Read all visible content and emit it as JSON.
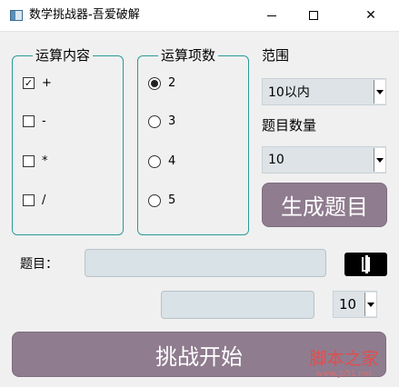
{
  "window": {
    "title": "数学挑战器-吾爱破解",
    "minimize_icon": "minimize-icon",
    "maximize_icon": "maximize-icon",
    "close_icon": "close-icon",
    "close_glyph": "✕"
  },
  "operations_group": {
    "title": "运算内容",
    "items": [
      {
        "label": "+",
        "checked": true
      },
      {
        "label": "-",
        "checked": false
      },
      {
        "label": "*",
        "checked": false
      },
      {
        "label": "/",
        "checked": false
      }
    ],
    "check_glyph": "✓"
  },
  "operands_group": {
    "title": "运算项数",
    "options": [
      {
        "label": "2",
        "selected": true
      },
      {
        "label": "3",
        "selected": false
      },
      {
        "label": "4",
        "selected": false
      },
      {
        "label": "5",
        "selected": false
      }
    ]
  },
  "range": {
    "label": "范围",
    "value": "10以内"
  },
  "question_count": {
    "label": "题目数量",
    "value": "10"
  },
  "generate_button": {
    "label": "生成题目"
  },
  "question_label": "题目：",
  "small_select": {
    "value": "10"
  },
  "start_button": {
    "label": "挑战开始"
  },
  "lcd_display": {
    "value": "1"
  },
  "watermark": {
    "main": "脚本之家",
    "sub": "www.jb51.net"
  },
  "colors": {
    "accent_border": "#2a9a96",
    "button_purple": "#8f7c8f",
    "field_bg": "#d9e2e6",
    "watermark": "#e04e4e"
  }
}
